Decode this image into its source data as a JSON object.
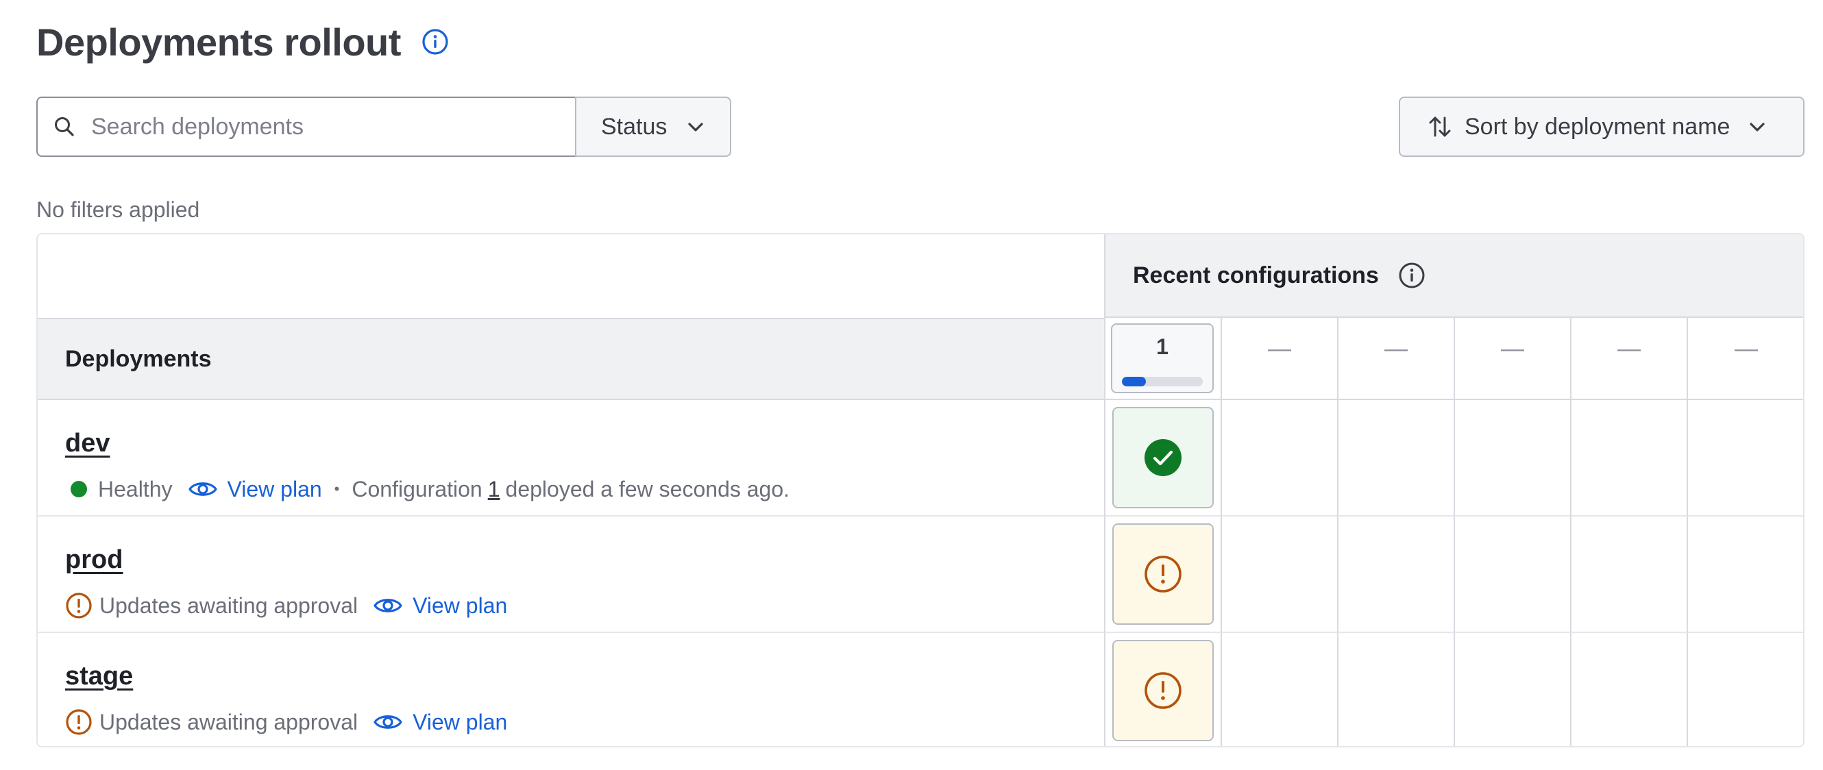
{
  "page": {
    "title": "Deployments rollout"
  },
  "toolbar": {
    "search_placeholder": "Search deployments",
    "status_label": "Status",
    "sort_label": "Sort by deployment name"
  },
  "filters_text": "No filters applied",
  "table": {
    "recent_configurations_label": "Recent configurations",
    "deployments_header": "Deployments",
    "configurations": [
      {
        "label": "1",
        "progress": 0.3
      },
      {
        "label": "—"
      },
      {
        "label": "—"
      },
      {
        "label": "—"
      },
      {
        "label": "—"
      },
      {
        "label": "—"
      }
    ],
    "rows": [
      {
        "name": "dev",
        "status": "Healthy",
        "status_color": "#138a2c",
        "view_plan": "View plan",
        "separator": "•",
        "config_prefix": "Configuration",
        "config_number": "1",
        "config_suffix": "deployed a few seconds ago.",
        "cell_state": "success"
      },
      {
        "name": "prod",
        "status": "Updates awaiting approval",
        "view_plan": "View plan",
        "cell_state": "warning"
      },
      {
        "name": "stage",
        "status": "Updates awaiting approval",
        "view_plan": "View plan",
        "cell_state": "warning"
      }
    ]
  },
  "colors": {
    "link": "#1860d8",
    "success": "#0f7a25",
    "warning": "#b3530b"
  }
}
